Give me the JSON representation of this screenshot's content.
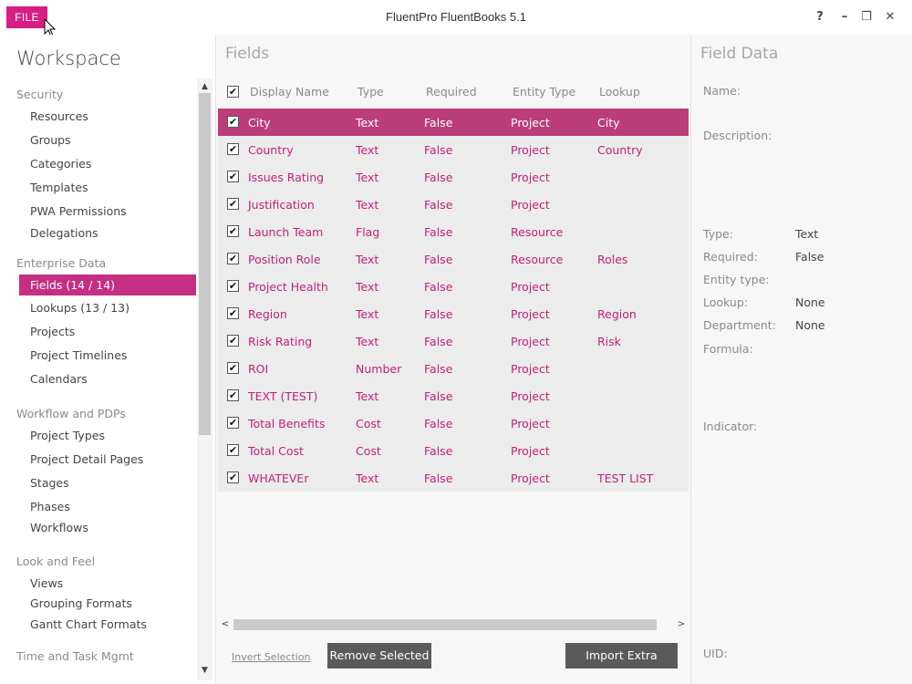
{
  "window": {
    "file_label": "FILE",
    "title": "FluentPro FluentBooks 5.1",
    "help": "?",
    "minimize": "–",
    "restore": "❐",
    "close": "✕"
  },
  "sidebar": {
    "title": "Workspace",
    "sections": [
      {
        "header": "Security",
        "items": [
          "Resources",
          "Groups",
          "Categories",
          "Templates",
          "PWA Permissions",
          "Delegations"
        ]
      },
      {
        "header": "Enterprise Data",
        "items": [
          "Fields (14 / 14)",
          "Lookups (13 / 13)",
          "Projects",
          "Project Timelines",
          "Calendars"
        ]
      },
      {
        "header": "Workflow and PDPs",
        "items": [
          "Project Types",
          "Project Detail Pages",
          "Stages",
          "Phases",
          "Workflows"
        ]
      },
      {
        "header": "Look and Feel",
        "items": [
          "Views",
          "Grouping Formats",
          "Gantt Chart Formats"
        ]
      },
      {
        "header": "Time and Task Mgmt",
        "items": []
      }
    ],
    "active_item": "Fields (14 / 14)"
  },
  "fields": {
    "title": "Fields",
    "columns": [
      "Display Name",
      "Type",
      "Required",
      "Entity Type",
      "Lookup"
    ],
    "rows": [
      {
        "name": "City",
        "type": "Text",
        "required": "False",
        "entity": "Project",
        "lookup": "City",
        "checked": true,
        "selected": true
      },
      {
        "name": "Country",
        "type": "Text",
        "required": "False",
        "entity": "Project",
        "lookup": "Country",
        "checked": true
      },
      {
        "name": "Issues Rating",
        "type": "Text",
        "required": "False",
        "entity": "Project",
        "lookup": "",
        "checked": true
      },
      {
        "name": "Justification",
        "type": "Text",
        "required": "False",
        "entity": "Project",
        "lookup": "",
        "checked": true
      },
      {
        "name": "Launch Team",
        "type": "Flag",
        "required": "False",
        "entity": "Resource",
        "lookup": "",
        "checked": true
      },
      {
        "name": "Position Role",
        "type": "Text",
        "required": "False",
        "entity": "Resource",
        "lookup": "Roles",
        "checked": true
      },
      {
        "name": "Project Health",
        "type": "Text",
        "required": "False",
        "entity": "Project",
        "lookup": "",
        "checked": true
      },
      {
        "name": "Region",
        "type": "Text",
        "required": "False",
        "entity": "Project",
        "lookup": "Region",
        "checked": true
      },
      {
        "name": "Risk Rating",
        "type": "Text",
        "required": "False",
        "entity": "Project",
        "lookup": "Risk",
        "checked": true
      },
      {
        "name": "ROI",
        "type": "Number",
        "required": "False",
        "entity": "Project",
        "lookup": "",
        "checked": true
      },
      {
        "name": "TEXT  (TEST)",
        "type": "Text",
        "required": "False",
        "entity": "Project",
        "lookup": "",
        "checked": true
      },
      {
        "name": "Total Benefits",
        "type": "Cost",
        "required": "False",
        "entity": "Project",
        "lookup": "",
        "checked": true
      },
      {
        "name": "Total Cost",
        "type": "Cost",
        "required": "False",
        "entity": "Project",
        "lookup": "",
        "checked": true
      },
      {
        "name": "WHATEVEr",
        "type": "Text",
        "required": "False",
        "entity": "Project",
        "lookup": "TEST LIST",
        "checked": true
      }
    ],
    "invert_selection": "Invert Selection",
    "remove_selected": "Remove Selected",
    "import_extra": "Import Extra"
  },
  "field_data": {
    "title": "Field Data",
    "name_label": "Name:",
    "description_label": "Description:",
    "type_label": "Type:",
    "type_value": "Text",
    "required_label": "Required:",
    "required_value": "False",
    "entity_label": "Entity type:",
    "entity_value": "",
    "lookup_label": "Lookup:",
    "lookup_value": "None",
    "department_label": "Department:",
    "department_value": "None",
    "formula_label": "Formula:",
    "indicator_label": "Indicator:",
    "uid_label": "UID:"
  },
  "colors": {
    "accent": "#d61f83",
    "selected_row": "#bb3e78",
    "link_text": "#c1207b"
  }
}
